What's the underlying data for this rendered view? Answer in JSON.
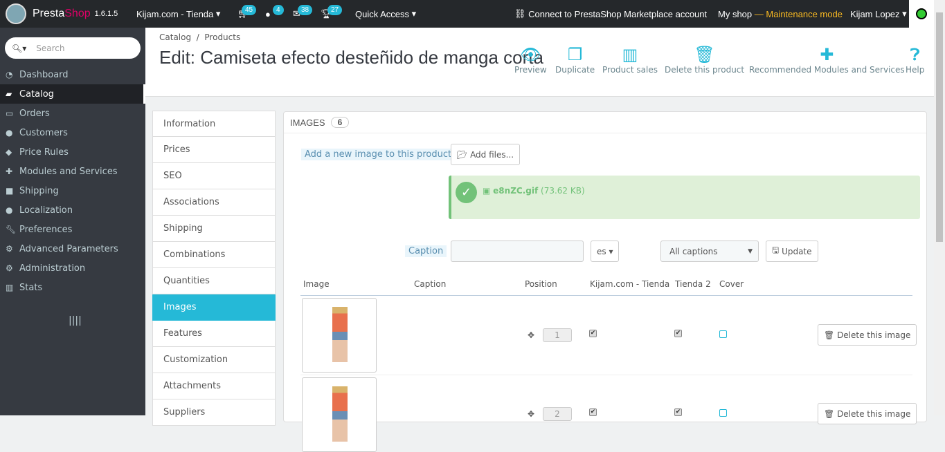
{
  "topbar": {
    "brand_a": "Presta",
    "brand_b": "Shop",
    "version": "1.6.1.5",
    "shop_selector": "Kijam.com - Tienda",
    "badges": {
      "orders": "45",
      "customers": "4",
      "messages": "38",
      "trophies": "27"
    },
    "quick_access": "Quick Access",
    "connect": "Connect to PrestaShop Marketplace account",
    "my_shop": "My shop",
    "maintenance": "— Maintenance mode",
    "user": "Kijam Lopez"
  },
  "sidebar": {
    "search_placeholder": "Search",
    "items": [
      {
        "label": "Dashboard",
        "icon": "dashboard-icon"
      },
      {
        "label": "Catalog",
        "icon": "book-icon"
      },
      {
        "label": "Orders",
        "icon": "credit-card-icon"
      },
      {
        "label": "Customers",
        "icon": "users-icon"
      },
      {
        "label": "Price Rules",
        "icon": "tags-icon"
      },
      {
        "label": "Modules and Services",
        "icon": "puzzle-icon"
      },
      {
        "label": "Shipping",
        "icon": "truck-icon"
      },
      {
        "label": "Localization",
        "icon": "globe-icon"
      },
      {
        "label": "Preferences",
        "icon": "wrench-icon"
      },
      {
        "label": "Advanced Parameters",
        "icon": "cogs-icon"
      },
      {
        "label": "Administration",
        "icon": "gear-icon"
      },
      {
        "label": "Stats",
        "icon": "bar-chart-icon"
      }
    ]
  },
  "header": {
    "breadcrumb": [
      "Catalog",
      "Products"
    ],
    "title": "Edit: Camiseta efecto desteñido de manga corta",
    "toolbar": [
      "Preview",
      "Duplicate",
      "Product sales",
      "Delete this product",
      "Recommended Modules and Services",
      "Help"
    ]
  },
  "tabs": [
    "Information",
    "Prices",
    "SEO",
    "Associations",
    "Shipping",
    "Combinations",
    "Quantities",
    "Images",
    "Features",
    "Customization",
    "Attachments",
    "Suppliers"
  ],
  "images": {
    "heading": "IMAGES",
    "count": "6",
    "add_label": "Add a new image to this product",
    "add_files": "Add files...",
    "upload_file": "e8nZC.gif",
    "upload_size": "(73.62 KB)",
    "caption_label": "Caption",
    "caption_value": "",
    "lang": "es",
    "caption_filter": "All captions",
    "update": "Update",
    "columns": [
      "Image",
      "Caption",
      "Position",
      "Kijam.com - Tienda",
      "Tienda 2",
      "Cover"
    ],
    "rows": [
      {
        "position": "1",
        "shop1": true,
        "shop2": true,
        "cover": false,
        "delete": "Delete this image"
      },
      {
        "position": "2",
        "shop1": true,
        "shop2": true,
        "cover": false,
        "delete": "Delete this image"
      }
    ]
  }
}
